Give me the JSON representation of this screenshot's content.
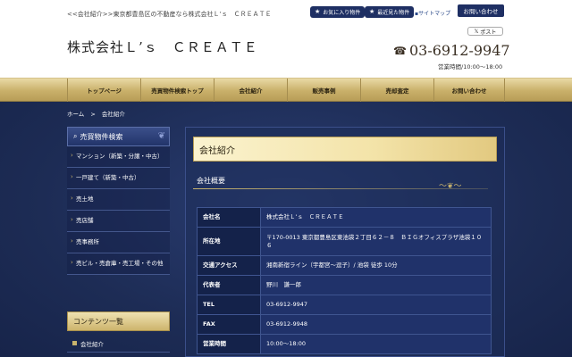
{
  "header": {
    "tagline": "<<会社紹介>>東京都豊島区の不動産なら株式会社Ｌ’ｓ　ＣＲＥＡＴＥ",
    "logo": "株式会社Ｌ’ｓ　ＣＲＥＡＴＥ",
    "favorites_label": "お気に入り物件",
    "recent_label": "最近見た物件",
    "sitemap_label": "サイトマップ",
    "contact_label": "お問い合わせ",
    "post_label": "ポスト",
    "phone": "03-6912-9947",
    "hours": "営業時間/10:00〜18:00"
  },
  "nav": {
    "items": [
      "トップページ",
      "売買物件検索トップ",
      "会社紹介",
      "販売事例",
      "売却査定",
      "お問い合わせ"
    ]
  },
  "breadcrumb": {
    "home": "ホーム",
    "sep": ">",
    "current": "会社紹介"
  },
  "sidebar": {
    "heading": "売買物件検索",
    "items": [
      "マンション（新築・分譲・中古）",
      "一戸建て（新築・中古）",
      "売土地",
      "売店舗",
      "売事務所",
      "売ビル・売倉庫・売工場・その他"
    ],
    "heading2": "コンテンツ一覧",
    "item2": "会社紹介"
  },
  "content": {
    "title": "会社紹介",
    "subtitle": "会社概要",
    "rows": [
      {
        "key": "会社名",
        "value": "株式会社Ｌ’ｓ　ＣＲＥＡＴＥ"
      },
      {
        "key": "所在地",
        "value": "〒170-0013 東京都豊島区東池袋２丁目６２－８　ＢＩＧオフィスプラザ池袋１０６"
      },
      {
        "key": "交通アクセス",
        "value": "湘南新宿ライン（宇都宮〜逗子）/ 池袋 徒歩 10分"
      },
      {
        "key": "代表者",
        "value": "野川　謙一郎"
      },
      {
        "key": "TEL",
        "value": "03-6912-9947"
      },
      {
        "key": "FAX",
        "value": "03-6912-9948"
      },
      {
        "key": "営業時間",
        "value": "10:00〜18:00"
      }
    ]
  },
  "colors": {
    "navy": "#1e2f63",
    "gold": "#c8b36d",
    "background": "#1f2f5a"
  }
}
